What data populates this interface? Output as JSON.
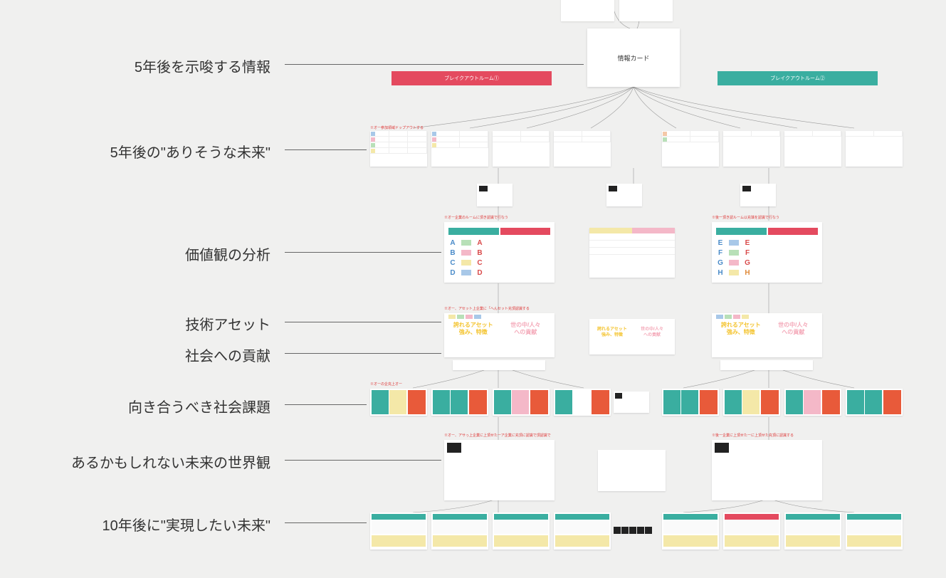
{
  "labels": {
    "r1": "5年後を示唆する情報",
    "r2": "5年後の\"ありそうな未来\"",
    "r3": "価値観の分析",
    "r4": "技術アセット",
    "r5": "社会への貢献",
    "r6": "向き合うべき社会課題",
    "r7": "あるかもしれない未来の世界観",
    "r8": "10年後に\"実現したい未来\""
  },
  "info_card": "情報カード",
  "banners": {
    "left": "ブレイクアウトルーム①",
    "right": "ブレイクアウトルーム②"
  },
  "values": {
    "left_letters": [
      "A",
      "B",
      "C",
      "D"
    ],
    "right_letters": [
      "E",
      "F",
      "G",
      "H"
    ]
  },
  "asset": {
    "left": "誇れるアセット\n強み、特徴",
    "right": "世の中/人々\nへの貢献"
  },
  "mini_labels": {
    "row2": "※オー参加領域ドップアウトする",
    "row3_left": "※オー企業のルームに頂き認識で行なう",
    "row3_right": "※後一頂き認ルーム以充填を認識で行なう",
    "row4": "※オー、アセット上企業に「へんセット充頂認識する",
    "row6": "※オーの企充上オー",
    "row7_left": "※オー、アサっ上企業に上頂せたーア企業に充頂に認識で頂認識で",
    "row7_right": "※後ー企業に上頂せたーに上頂せた充頂に認識する"
  }
}
